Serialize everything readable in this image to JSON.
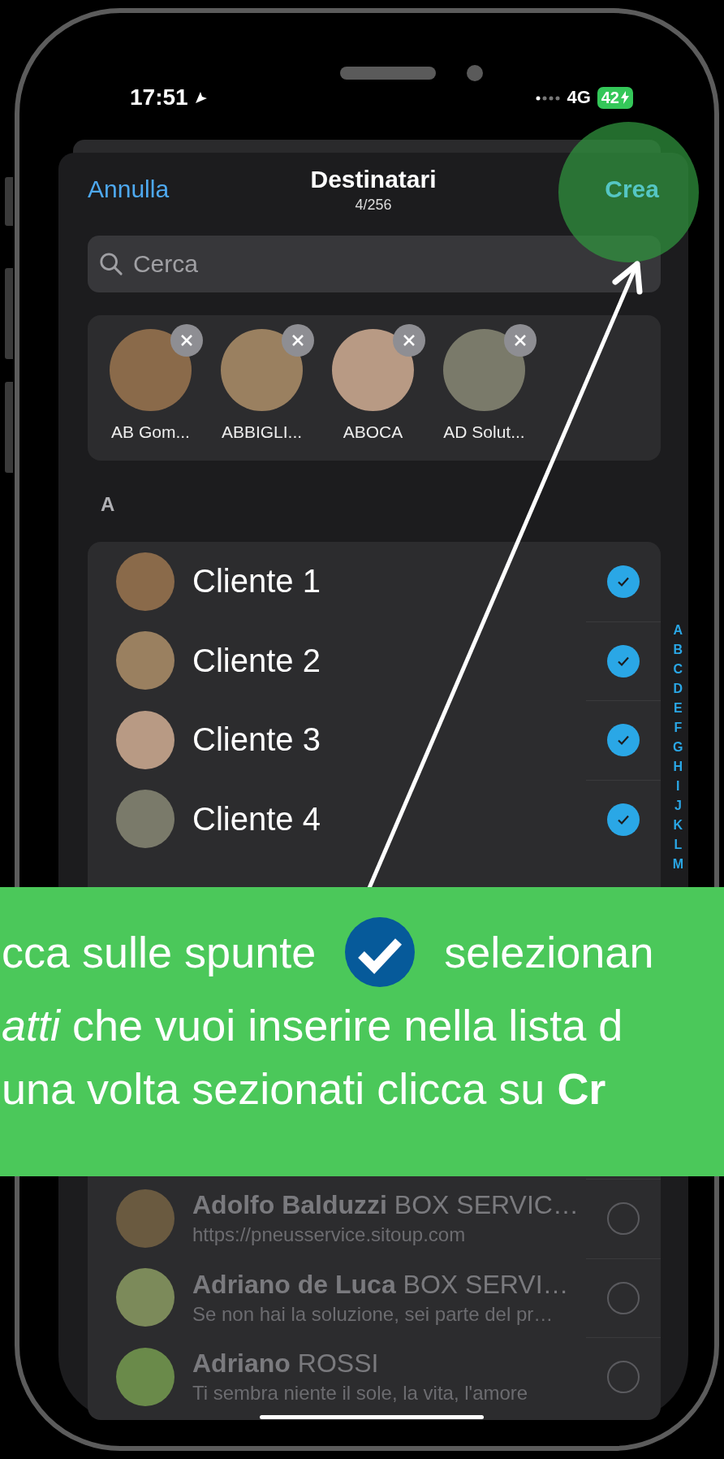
{
  "status_bar": {
    "time": "17:51",
    "network": "4G",
    "battery": "42"
  },
  "header": {
    "cancel": "Annulla",
    "title": "Destinatari",
    "count": "4/256",
    "action": "Crea"
  },
  "search": {
    "placeholder": "Cerca"
  },
  "chips": [
    {
      "label": "AB Gom..."
    },
    {
      "label": "ABBIGLI..."
    },
    {
      "label": "ABOCA"
    },
    {
      "label": "AD Solut..."
    }
  ],
  "section": "A",
  "contacts_top": [
    {
      "kind": "overlay",
      "label": "Cliente 1",
      "checked": true
    },
    {
      "kind": "overlay",
      "label": "Cliente 2",
      "checked": true
    },
    {
      "kind": "overlay",
      "label": "Cliente 3",
      "checked": true
    },
    {
      "kind": "overlay",
      "label": "Cliente 4",
      "checked": true
    }
  ],
  "contacts_bottom": [
    {
      "kind": "contact",
      "title": "**Adolfo Balduzzi** BOX SERVIC…",
      "subtitle": "https://pneusservice.sitoup.com",
      "checked": false
    },
    {
      "kind": "contact",
      "title": "**Adriano de Luca** BOX SERVI…",
      "subtitle": "Se non hai la soluzione, sei parte del pr…",
      "checked": false
    },
    {
      "kind": "contact",
      "title": "**Adriano** ROSSI",
      "subtitle": "Ti sembra niente il sole, la vita, l'amore",
      "checked": false
    }
  ],
  "index_letters": [
    "A",
    "B",
    "C",
    "D",
    "E",
    "F",
    "G",
    "H",
    "I",
    "J",
    "K",
    "L",
    "M"
  ],
  "banner": {
    "lines": [
      {
        "parts": [
          {
            "kind": "text",
            "text": "cca sulle spunte"
          },
          {
            "kind": "check-icon"
          },
          {
            "kind": "text",
            "text": "selezionan"
          }
        ]
      },
      {
        "parts": [
          {
            "kind": "text",
            "text": "*atti* che vuoi inserire nella lista d"
          }
        ]
      },
      {
        "parts": [
          {
            "kind": "text",
            "text": "una volta sezionati clicca su **Cr**"
          }
        ]
      }
    ]
  }
}
